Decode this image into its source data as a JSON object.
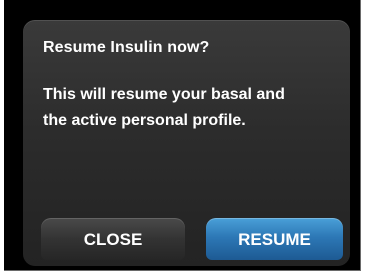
{
  "dialog": {
    "title": "Resume Insulin now?",
    "message_lines": [
      "This will resume your basal and",
      "the active personal profile."
    ]
  },
  "buttons": {
    "close_label": "CLOSE",
    "resume_label": "RESUME"
  },
  "colors": {
    "background": "#000000",
    "dialog_background": "#2e2e2e",
    "close_button": "#333333",
    "resume_button": "#2d78b6",
    "text": "#ffffff"
  }
}
